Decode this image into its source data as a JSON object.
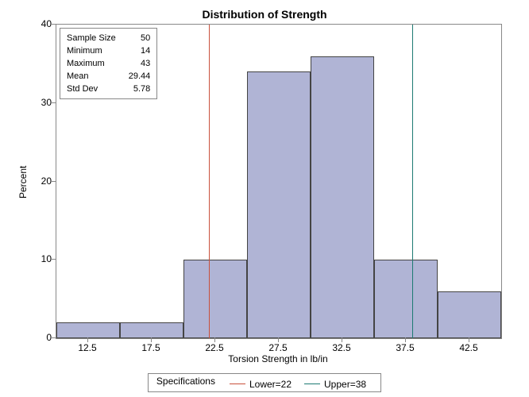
{
  "chart_data": {
    "type": "bar",
    "title": "Distribution of Strength",
    "xlabel": "Torsion Strength in lb/in",
    "ylabel": "Percent",
    "x_ticks": [
      12.5,
      17.5,
      22.5,
      27.5,
      32.5,
      37.5,
      42.5
    ],
    "y_ticks": [
      0,
      10,
      20,
      30,
      40
    ],
    "ylim": [
      0,
      40
    ],
    "xlim": [
      10,
      45
    ],
    "bin_width": 5,
    "categories": [
      12.5,
      17.5,
      22.5,
      27.5,
      32.5,
      37.5,
      42.5
    ],
    "values": [
      2,
      2,
      10,
      34,
      36,
      10,
      6
    ],
    "stats": {
      "Sample Size": 50,
      "Minimum": 14,
      "Maximum": 43,
      "Mean": 29.44,
      "Std Dev": 5.78
    },
    "spec_lines": [
      {
        "name": "Lower",
        "value": 22,
        "label": "Lower=22",
        "color": "#c9513c"
      },
      {
        "name": "Upper",
        "value": 38,
        "label": "Upper=38",
        "color": "#1d7a72"
      }
    ],
    "legend_title": "Specifications",
    "bar_fill": "#b0b4d5"
  }
}
